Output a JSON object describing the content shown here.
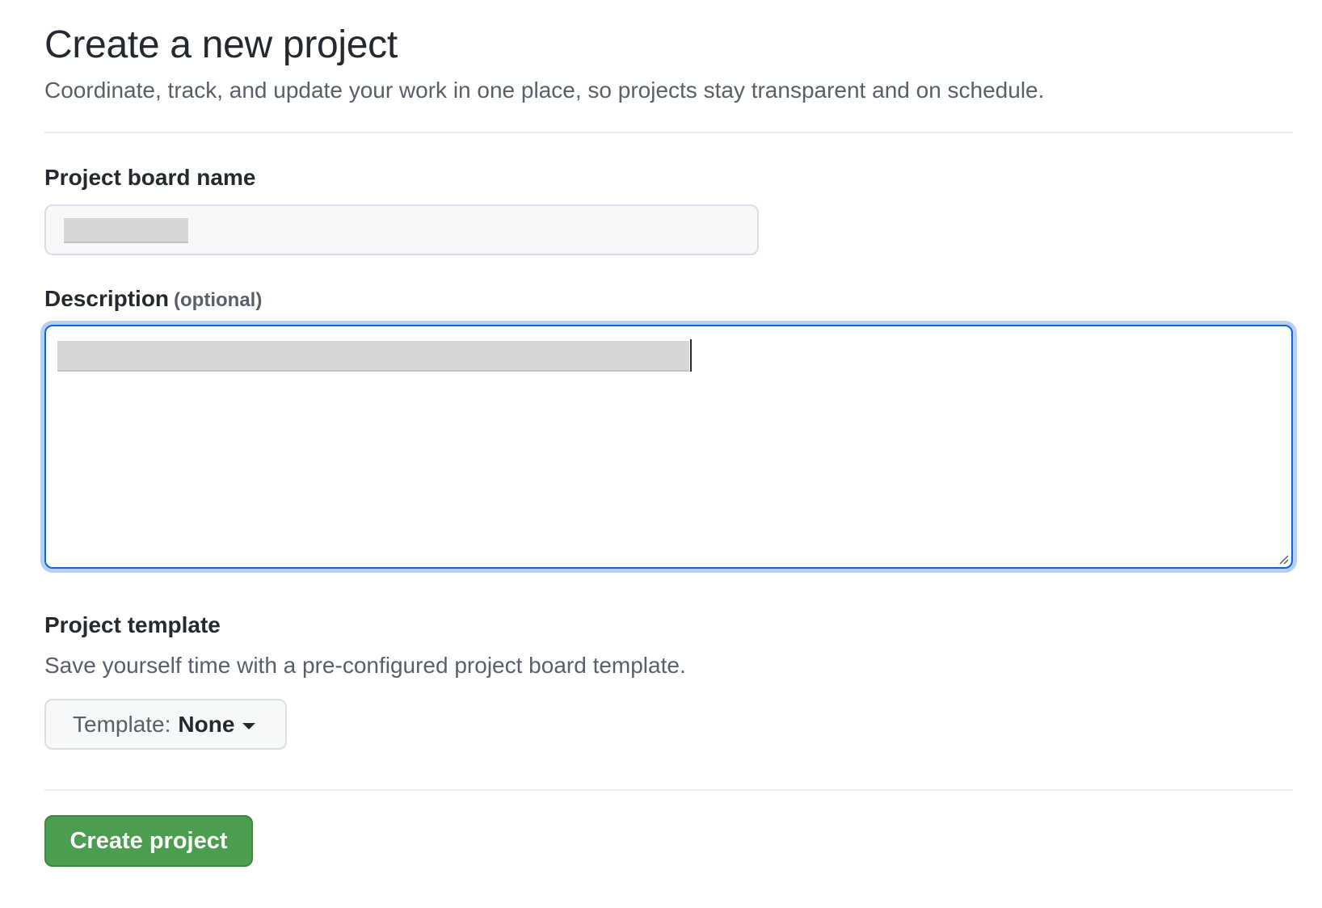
{
  "header": {
    "title": "Create a new project",
    "subtitle": "Coordinate, track, and update your work in one place, so projects stay transparent and on schedule."
  },
  "form": {
    "name_label": "Project board name",
    "name_value": "",
    "description_label": "Description",
    "description_optional": "(optional)",
    "description_value": "",
    "template_label": "Project template",
    "template_help": "Save yourself time with a pre-configured project board template.",
    "template_button_prefix": "Template:",
    "template_button_value": "None",
    "submit_label": "Create project"
  },
  "colors": {
    "primary_button": "#4b9d50",
    "focus_border": "#0969da",
    "focus_ring": "#b6cff5",
    "muted_text": "#57606a"
  },
  "icons": {
    "template_dropdown": "caret-down-icon",
    "textarea_resize": "resize-handle-icon"
  }
}
